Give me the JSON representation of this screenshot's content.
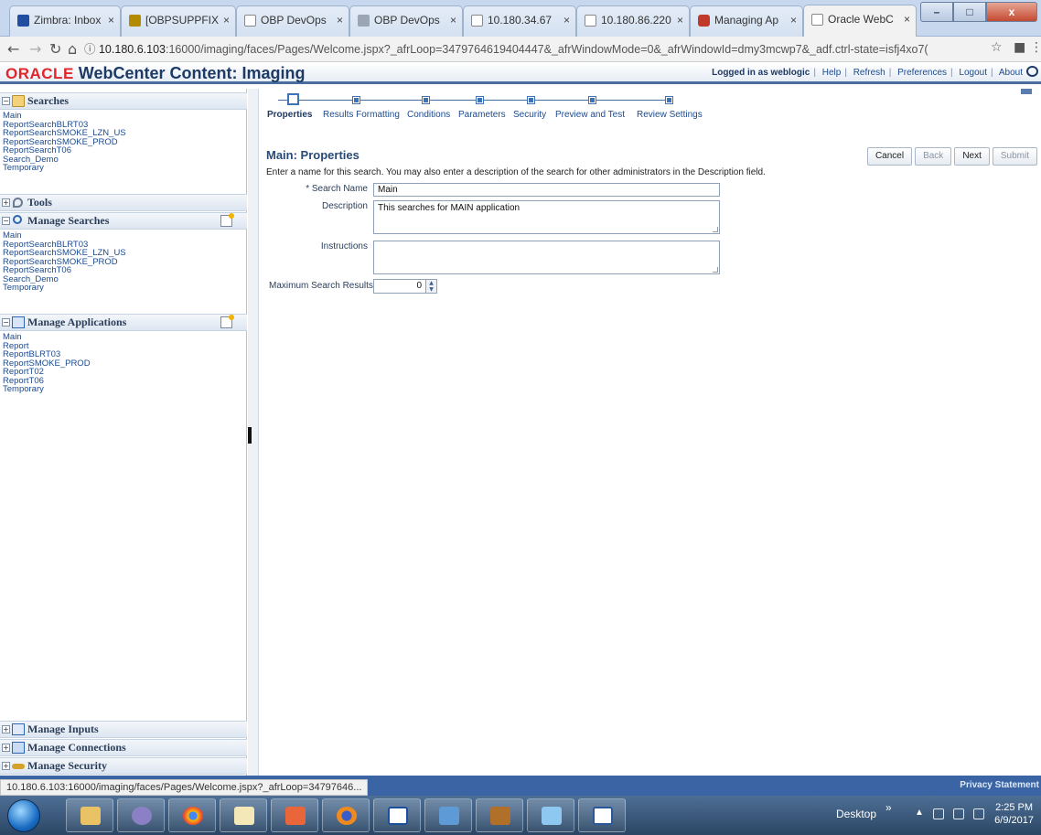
{
  "browser": {
    "tabs": [
      {
        "label": "Zimbra: Inbox"
      },
      {
        "label": "[OBPSUPPFIX"
      },
      {
        "label": "OBP DevOps"
      },
      {
        "label": "OBP DevOps"
      },
      {
        "label": "10.180.34.67"
      },
      {
        "label": "10.180.86.220"
      },
      {
        "label": "Managing Ap"
      },
      {
        "label": "Oracle WebC"
      }
    ],
    "window_controls": {
      "minimize": "–",
      "maximize": "□",
      "close": "x"
    },
    "url_host": "10.180.6.103",
    "url_rest": ":16000/imaging/faces/Pages/Welcome.jspx?_afrLoop=3479764619404447&_afrWindowMode=0&_afrWindowId=dmy3mcwp7&_adf.ctrl-state=isfj4xo7("
  },
  "header": {
    "brand_oracle": "ORACLE",
    "brand_product": " WebCenter Content: Imaging",
    "logged_in": "Logged in as weblogic",
    "links": [
      "Help",
      "Refresh",
      "Preferences",
      "Logout",
      "About"
    ]
  },
  "sidebar": {
    "searches": {
      "title": "Searches",
      "items": [
        "Main",
        "ReportSearchBLRT03",
        "ReportSearchSMOKE_LZN_US",
        "ReportSearchSMOKE_PROD",
        "ReportSearchT06",
        "Search_Demo",
        "Temporary"
      ]
    },
    "tools": {
      "title": "Tools"
    },
    "manage_searches": {
      "title": "Manage Searches",
      "items": [
        "Main",
        "ReportSearchBLRT03",
        "ReportSearchSMOKE_LZN_US",
        "ReportSearchSMOKE_PROD",
        "ReportSearchT06",
        "Search_Demo",
        "Temporary"
      ]
    },
    "manage_applications": {
      "title": "Manage Applications",
      "items": [
        "Main",
        "Report",
        "ReportBLRT03",
        "ReportSMOKE_PROD",
        "ReportT02",
        "ReportT06",
        "Temporary"
      ]
    },
    "manage_inputs": {
      "title": "Manage Inputs"
    },
    "manage_connections": {
      "title": "Manage Connections"
    },
    "manage_security": {
      "title": "Manage Security"
    }
  },
  "train": {
    "steps": [
      "Properties",
      "Results Formatting",
      "Conditions",
      "Parameters",
      "Security",
      "Preview and Test",
      "Review Settings"
    ],
    "current": "Properties"
  },
  "main": {
    "title": "Main: Properties",
    "description": "Enter a name for this search. You may also enter a description of the search for other administrators in the Description field.",
    "buttons": {
      "cancel": "Cancel",
      "back": "Back",
      "next": "Next",
      "submit": "Submit"
    },
    "fields": {
      "search_name_label": "* Search Name",
      "search_name_value": "Main",
      "description_label": "Description",
      "description_value": "This searches for MAIN application",
      "instructions_label": "Instructions",
      "instructions_value": "",
      "max_results_label": "Maximum Search Results",
      "max_results_value": "0"
    }
  },
  "footer": {
    "status_url": "10.180.6.103:16000/imaging/faces/Pages/Welcome.jspx?_afrLoop=34797646...",
    "privacy": "Privacy Statement"
  },
  "taskbar": {
    "desktop_label": "Desktop",
    "chevron": "»",
    "time": "2:25 PM",
    "date": "6/9/2017"
  }
}
